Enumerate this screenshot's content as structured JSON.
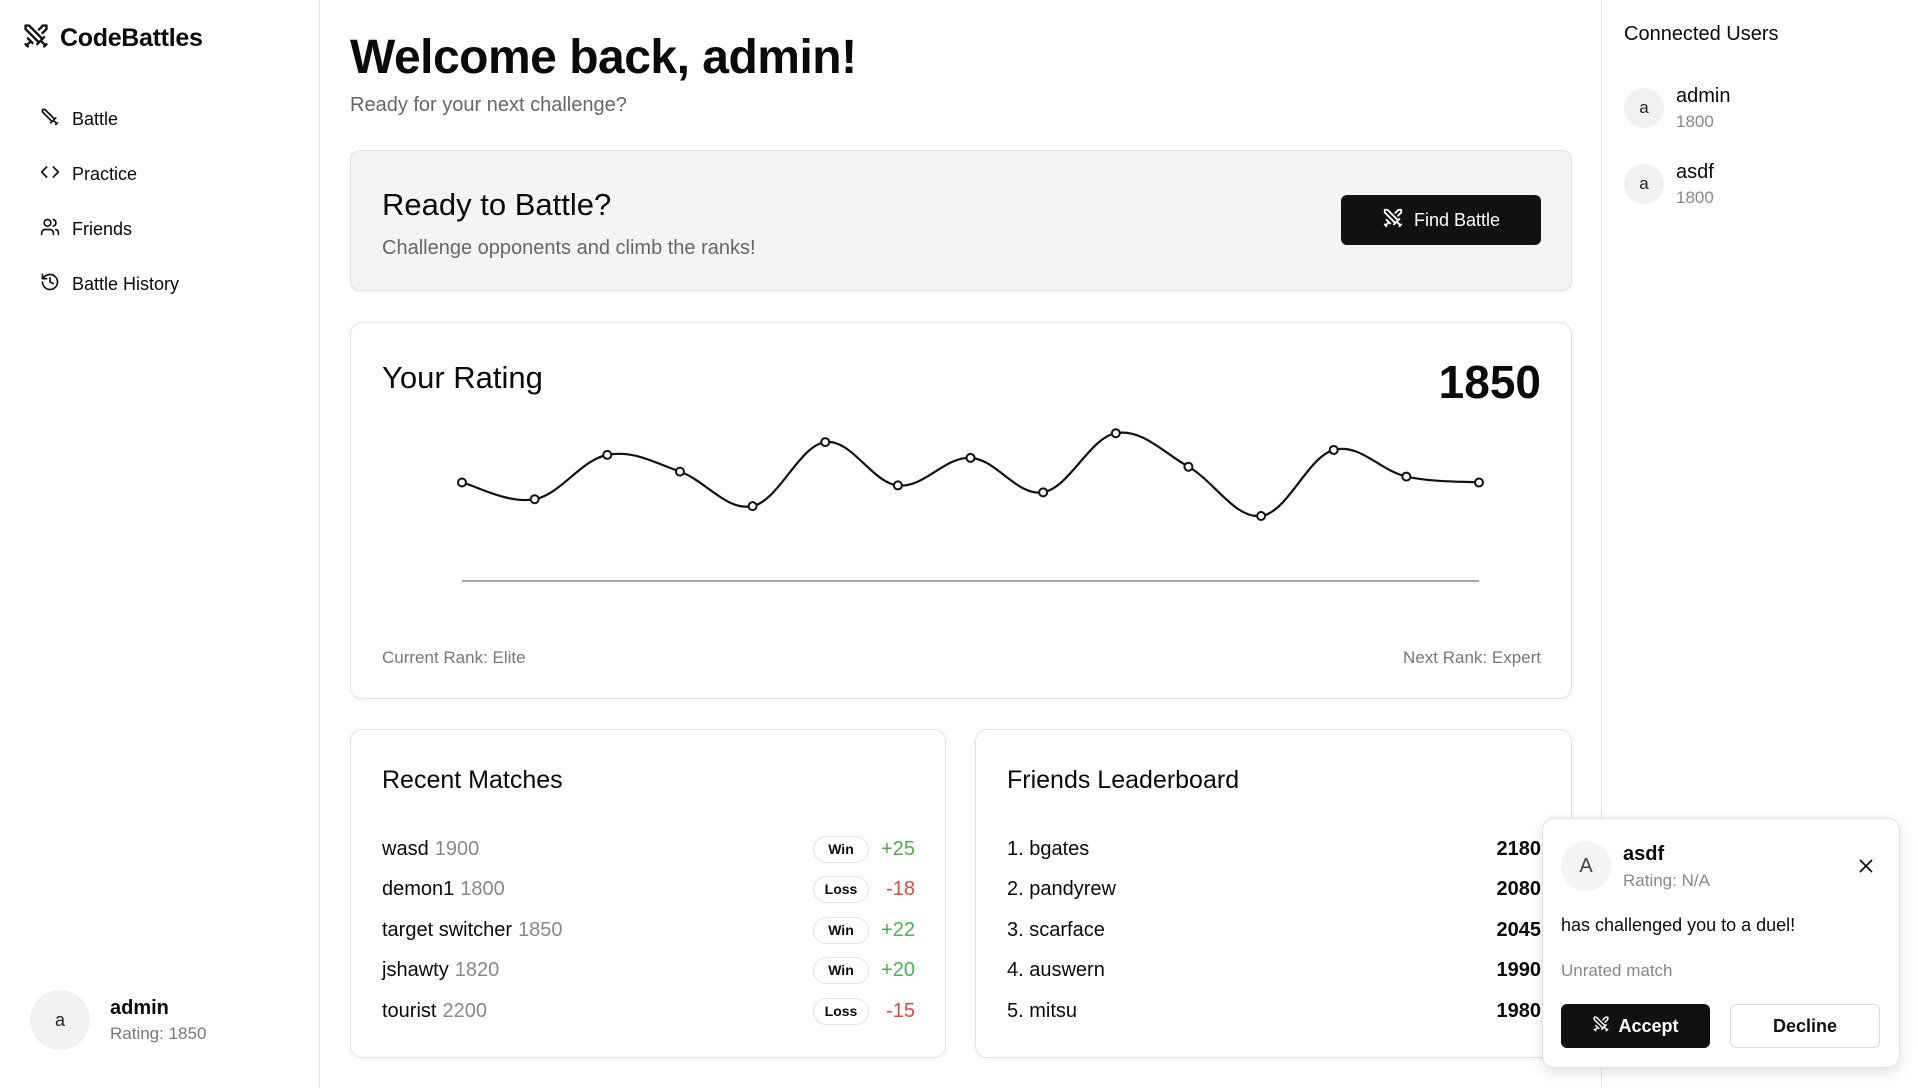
{
  "brand": {
    "name": "CodeBattles",
    "icon": "crossed-swords-icon"
  },
  "nav": [
    {
      "label": "Battle",
      "icon": "sword-icon"
    },
    {
      "label": "Practice",
      "icon": "code-icon"
    },
    {
      "label": "Friends",
      "icon": "users-icon"
    },
    {
      "label": "Battle History",
      "icon": "history-icon"
    }
  ],
  "current_user": {
    "avatar": "a",
    "name": "admin",
    "rating": "Rating: 1850"
  },
  "header": {
    "title": "Welcome back, admin!",
    "subtitle": "Ready for your next challenge?"
  },
  "battle": {
    "title": "Ready to Battle?",
    "subtitle": "Challenge opponents and climb the ranks!",
    "button": "Find Battle"
  },
  "rating": {
    "title": "Your Rating",
    "value": "1850",
    "current_rank": "Current Rank: Elite",
    "next_rank": "Next Rank: Expert"
  },
  "chart_data": {
    "type": "line",
    "x": [
      1,
      2,
      3,
      4,
      5,
      6,
      7,
      8,
      9,
      10,
      11,
      12,
      13,
      14,
      15
    ],
    "values": [
      52,
      35,
      80,
      63,
      28,
      93,
      49,
      77,
      42,
      102,
      68,
      18,
      85,
      58,
      52
    ],
    "ylim": [
      -48,
      155
    ],
    "grid": false,
    "line_color": "#111111"
  },
  "recent_matches": {
    "title": "Recent Matches",
    "rows": [
      {
        "opponent": "wasd",
        "opp_rating": "1900",
        "result": "Win",
        "delta": "+25"
      },
      {
        "opponent": "demon1",
        "opp_rating": "1800",
        "result": "Loss",
        "delta": "-18"
      },
      {
        "opponent": "target switcher",
        "opp_rating": "1850",
        "result": "Win",
        "delta": "+22"
      },
      {
        "opponent": "jshawty",
        "opp_rating": "1820",
        "result": "Win",
        "delta": "+20"
      },
      {
        "opponent": "tourist",
        "opp_rating": "2200",
        "result": "Loss",
        "delta": "-15"
      }
    ]
  },
  "leaderboard": {
    "title": "Friends Leaderboard",
    "rows": [
      {
        "name": "1. bgates",
        "score": "2180"
      },
      {
        "name": "2. pandyrew",
        "score": "2080"
      },
      {
        "name": "3. scarface",
        "score": "2045"
      },
      {
        "name": "4. auswern",
        "score": "1990"
      },
      {
        "name": "5. mitsu",
        "score": "1980"
      }
    ]
  },
  "connected_users": {
    "title": "Connected Users",
    "users": [
      {
        "avatar": "a",
        "name": "admin",
        "rating": "1800"
      },
      {
        "avatar": "a",
        "name": "asdf",
        "rating": "1800"
      }
    ]
  },
  "challenge": {
    "avatar": "A",
    "name": "asdf",
    "rating": "Rating: N/A",
    "message": "has challenged you to a duel!",
    "mode": "Unrated match",
    "accept": "Accept",
    "decline": "Decline"
  },
  "colors": {
    "win": "#4caf50",
    "loss": "#e0473e",
    "primary": "#111111"
  }
}
